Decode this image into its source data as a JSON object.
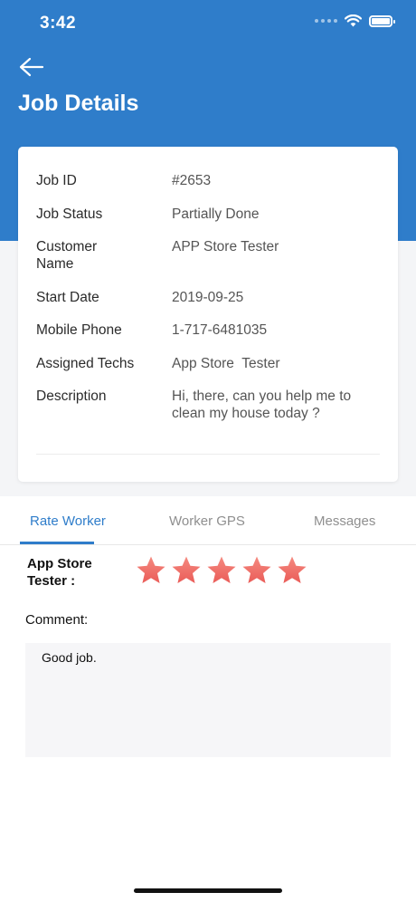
{
  "status_bar": {
    "time": "3:42"
  },
  "header": {
    "title": "Job Details"
  },
  "job": {
    "rows": [
      {
        "label": "Job ID",
        "value": "#2653"
      },
      {
        "label": "Job Status",
        "value": "Partially Done"
      },
      {
        "label": "Customer Name",
        "value": "APP Store Tester"
      },
      {
        "label": "Start Date",
        "value": "2019-09-25"
      },
      {
        "label": "Mobile Phone",
        "value": "1-717-6481035"
      },
      {
        "label": "Assigned Techs",
        "value": "App Store  Tester"
      },
      {
        "label": "Description",
        "value": "Hi, there, can you help me to clean my house today ?"
      }
    ]
  },
  "tabs": [
    {
      "label": "Rate Worker",
      "active": true
    },
    {
      "label": "Worker GPS",
      "active": false
    },
    {
      "label": "Messages",
      "active": false
    }
  ],
  "rating": {
    "worker_label": "App Store Tester :",
    "stars": 5,
    "max_stars": 5,
    "star_color": "#f0706a"
  },
  "comment": {
    "label": "Comment:",
    "value": "Good job."
  },
  "colors": {
    "primary": "#2f7dca"
  }
}
